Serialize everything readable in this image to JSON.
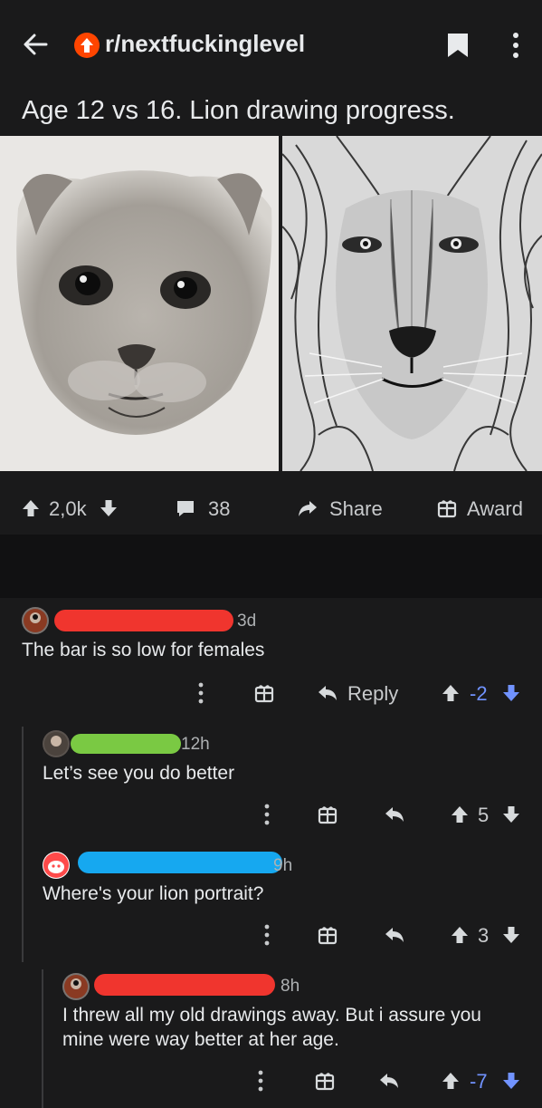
{
  "header": {
    "subreddit": "r/nextfuckinglevel",
    "post_title": "Age 12 vs 16. Lion drawing progress."
  },
  "post_actions": {
    "score": "2,0k",
    "comments": "38",
    "share_label": "Share",
    "award_label": "Award"
  },
  "comments": [
    {
      "age": "3d",
      "text": "The bar is so low for females",
      "reply_label": "Reply",
      "score": "-2"
    },
    {
      "age": "12h",
      "text": "Let’s see you do better",
      "score": "5"
    },
    {
      "age": "9h",
      "text": "Where's your lion portrait?",
      "score": "3"
    },
    {
      "age": "8h",
      "text_line1": "I threw all my old drawings away. But i assure you",
      "text_line2": "mine were way better at her age.",
      "score": "-7"
    }
  ],
  "colors": {
    "background": "#1a1a1b",
    "upvote_orange": "#ff4500",
    "downvote_blue": "#7193ff",
    "redact_red": "#f0352e",
    "redact_green": "#7ac943",
    "redact_blue": "#16a8f0"
  }
}
